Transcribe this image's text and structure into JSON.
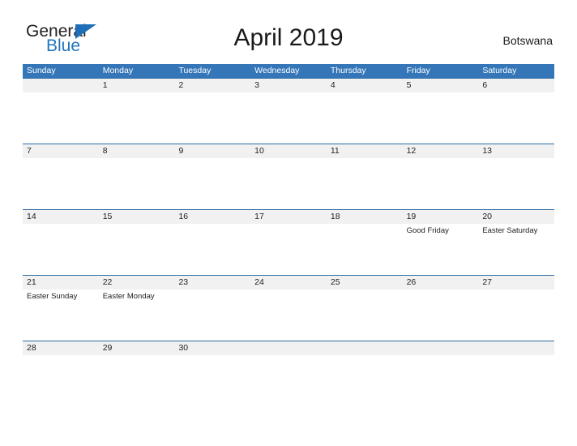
{
  "brand": {
    "word1": "General",
    "word2": "Blue",
    "triangle_color": "#1e6fb8",
    "word2_color": "#2175bd"
  },
  "header": {
    "title": "April 2019",
    "region": "Botswana"
  },
  "theme": {
    "header_blue": "#3476b8",
    "row_rule_blue": "#2e6da4",
    "date_band_gray": "#f1f1f1",
    "page_background": "#ffffff",
    "text_color": "#222222"
  },
  "calendar": {
    "weekdays": [
      "Sunday",
      "Monday",
      "Tuesday",
      "Wednesday",
      "Thursday",
      "Friday",
      "Saturday"
    ],
    "weeks": [
      [
        {
          "day": "",
          "event": ""
        },
        {
          "day": "1",
          "event": ""
        },
        {
          "day": "2",
          "event": ""
        },
        {
          "day": "3",
          "event": ""
        },
        {
          "day": "4",
          "event": ""
        },
        {
          "day": "5",
          "event": ""
        },
        {
          "day": "6",
          "event": ""
        }
      ],
      [
        {
          "day": "7",
          "event": ""
        },
        {
          "day": "8",
          "event": ""
        },
        {
          "day": "9",
          "event": ""
        },
        {
          "day": "10",
          "event": ""
        },
        {
          "day": "11",
          "event": ""
        },
        {
          "day": "12",
          "event": ""
        },
        {
          "day": "13",
          "event": ""
        }
      ],
      [
        {
          "day": "14",
          "event": ""
        },
        {
          "day": "15",
          "event": ""
        },
        {
          "day": "16",
          "event": ""
        },
        {
          "day": "17",
          "event": ""
        },
        {
          "day": "18",
          "event": ""
        },
        {
          "day": "19",
          "event": "Good Friday"
        },
        {
          "day": "20",
          "event": "Easter Saturday"
        }
      ],
      [
        {
          "day": "21",
          "event": "Easter Sunday"
        },
        {
          "day": "22",
          "event": "Easter Monday"
        },
        {
          "day": "23",
          "event": ""
        },
        {
          "day": "24",
          "event": ""
        },
        {
          "day": "25",
          "event": ""
        },
        {
          "day": "26",
          "event": ""
        },
        {
          "day": "27",
          "event": ""
        }
      ],
      [
        {
          "day": "28",
          "event": ""
        },
        {
          "day": "29",
          "event": ""
        },
        {
          "day": "30",
          "event": ""
        },
        {
          "day": "",
          "event": ""
        },
        {
          "day": "",
          "event": ""
        },
        {
          "day": "",
          "event": ""
        },
        {
          "day": "",
          "event": ""
        }
      ]
    ]
  }
}
